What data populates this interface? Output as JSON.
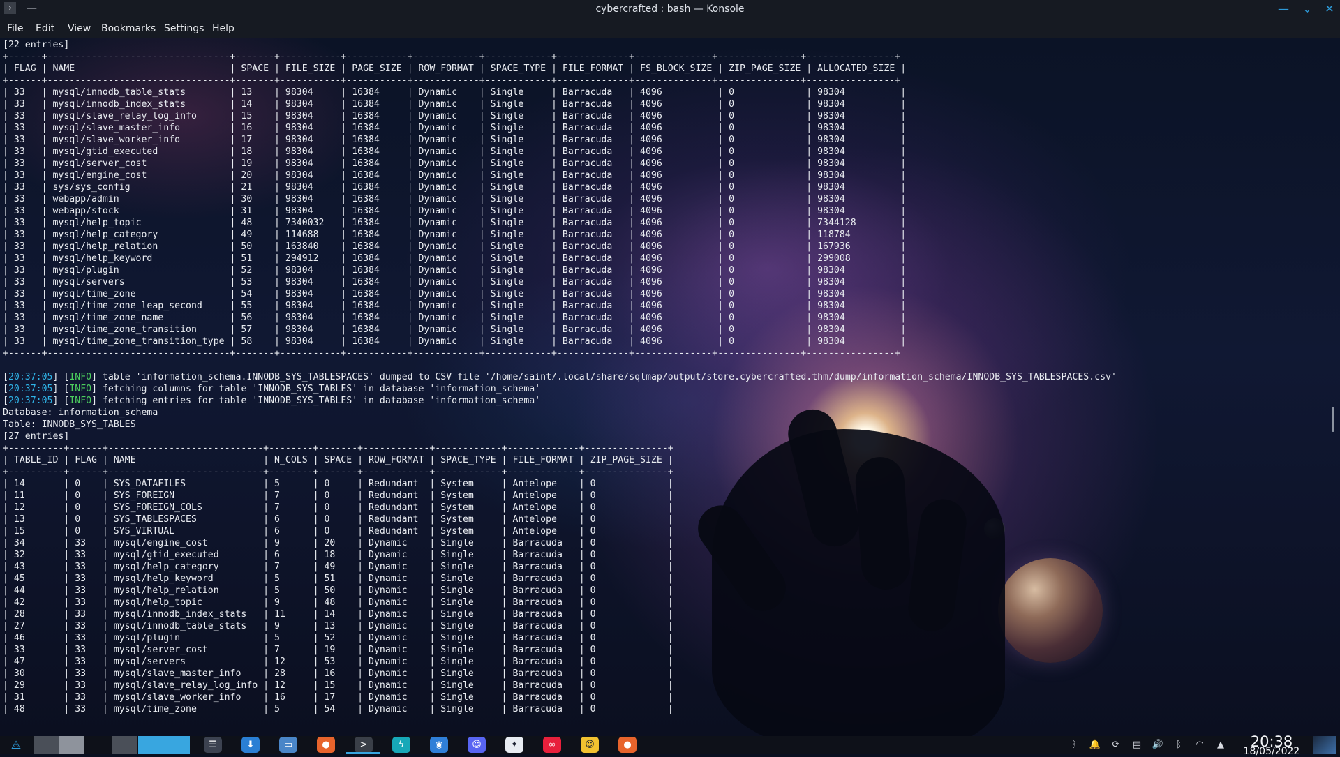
{
  "window": {
    "title": "cybercrafted : bash — Konsole",
    "app_icon": "terminal-icon"
  },
  "menu": [
    "File",
    "Edit",
    "View",
    "Bookmarks",
    "Settings",
    "Help"
  ],
  "terminal_lines": [
    "[22 entries]",
    "+------+---------------------------------+-------+-----------+-----------+------------+------------+-------------+--------------+---------------+----------------+",
    "| FLAG | NAME                            | SPACE | FILE_SIZE | PAGE_SIZE | ROW_FORMAT | SPACE_TYPE | FILE_FORMAT | FS_BLOCK_SIZE | ZIP_PAGE_SIZE | ALLOCATED_SIZE |",
    "+------+---------------------------------+-------+-----------+-----------+------------+------------+-------------+--------------+---------------+----------------+",
    "| 33   | mysql/innodb_table_stats        | 13    | 98304     | 16384     | Dynamic    | Single     | Barracuda   | 4096          | 0             | 98304          |",
    "| 33   | mysql/innodb_index_stats        | 14    | 98304     | 16384     | Dynamic    | Single     | Barracuda   | 4096          | 0             | 98304          |",
    "| 33   | mysql/slave_relay_log_info      | 15    | 98304     | 16384     | Dynamic    | Single     | Barracuda   | 4096          | 0             | 98304          |",
    "| 33   | mysql/slave_master_info         | 16    | 98304     | 16384     | Dynamic    | Single     | Barracuda   | 4096          | 0             | 98304          |",
    "| 33   | mysql/slave_worker_info         | 17    | 98304     | 16384     | Dynamic    | Single     | Barracuda   | 4096          | 0             | 98304          |",
    "| 33   | mysql/gtid_executed             | 18    | 98304     | 16384     | Dynamic    | Single     | Barracuda   | 4096          | 0             | 98304          |",
    "| 33   | mysql/server_cost               | 19    | 98304     | 16384     | Dynamic    | Single     | Barracuda   | 4096          | 0             | 98304          |",
    "| 33   | mysql/engine_cost               | 20    | 98304     | 16384     | Dynamic    | Single     | Barracuda   | 4096          | 0             | 98304          |",
    "| 33   | sys/sys_config                  | 21    | 98304     | 16384     | Dynamic    | Single     | Barracuda   | 4096          | 0             | 98304          |",
    "| 33   | webapp/admin                    | 30    | 98304     | 16384     | Dynamic    | Single     | Barracuda   | 4096          | 0             | 98304          |",
    "| 33   | webapp/stock                    | 31    | 98304     | 16384     | Dynamic    | Single     | Barracuda   | 4096          | 0             | 98304          |",
    "| 33   | mysql/help_topic                | 48    | 7340032   | 16384     | Dynamic    | Single     | Barracuda   | 4096          | 0             | 7344128        |",
    "| 33   | mysql/help_category             | 49    | 114688    | 16384     | Dynamic    | Single     | Barracuda   | 4096          | 0             | 118784         |",
    "| 33   | mysql/help_relation             | 50    | 163840    | 16384     | Dynamic    | Single     | Barracuda   | 4096          | 0             | 167936         |",
    "| 33   | mysql/help_keyword              | 51    | 294912    | 16384     | Dynamic    | Single     | Barracuda   | 4096          | 0             | 299008         |",
    "| 33   | mysql/plugin                    | 52    | 98304     | 16384     | Dynamic    | Single     | Barracuda   | 4096          | 0             | 98304          |",
    "| 33   | mysql/servers                   | 53    | 98304     | 16384     | Dynamic    | Single     | Barracuda   | 4096          | 0             | 98304          |",
    "| 33   | mysql/time_zone                 | 54    | 98304     | 16384     | Dynamic    | Single     | Barracuda   | 4096          | 0             | 98304          |",
    "| 33   | mysql/time_zone_leap_second     | 55    | 98304     | 16384     | Dynamic    | Single     | Barracuda   | 4096          | 0             | 98304          |",
    "| 33   | mysql/time_zone_name            | 56    | 98304     | 16384     | Dynamic    | Single     | Barracuda   | 4096          | 0             | 98304          |",
    "| 33   | mysql/time_zone_transition      | 57    | 98304     | 16384     | Dynamic    | Single     | Barracuda   | 4096          | 0             | 98304          |",
    "| 33   | mysql/time_zone_transition_type | 58    | 98304     | 16384     | Dynamic    | Single     | Barracuda   | 4096          | 0             | 98304          |",
    "+------+---------------------------------+-------+-----------+-----------+------------+------------+-------------+--------------+---------------+----------------+",
    "",
    "[20:37:05] [INFO] table 'information_schema.INNODB_SYS_TABLESPACES' dumped to CSV file '/home/saint/.local/share/sqlmap/output/store.cybercrafted.thm/dump/information_schema/INNODB_SYS_TABLESPACES.csv'",
    "[20:37:05] [INFO] fetching columns for table 'INNODB_SYS_TABLES' in database 'information_schema'",
    "[20:37:05] [INFO] fetching entries for table 'INNODB_SYS_TABLES' in database 'information_schema'",
    "Database: information_schema",
    "Table: INNODB_SYS_TABLES",
    "[27 entries]",
    "+----------+------+----------------------------+--------+-------+------------+------------+-------------+---------------+",
    "| TABLE_ID | FLAG | NAME                       | N_COLS | SPACE | ROW_FORMAT | SPACE_TYPE | FILE_FORMAT | ZIP_PAGE_SIZE |",
    "+----------+------+----------------------------+--------+-------+------------+------------+-------------+---------------+",
    "| 14       | 0    | SYS_DATAFILES              | 5      | 0     | Redundant  | System     | Antelope    | 0             |",
    "| 11       | 0    | SYS_FOREIGN                | 7      | 0     | Redundant  | System     | Antelope    | 0             |",
    "| 12       | 0    | SYS_FOREIGN_COLS           | 7      | 0     | Redundant  | System     | Antelope    | 0             |",
    "| 13       | 0    | SYS_TABLESPACES            | 6      | 0     | Redundant  | System     | Antelope    | 0             |",
    "| 15       | 0    | SYS_VIRTUAL                | 6      | 0     | Redundant  | System     | Antelope    | 0             |",
    "| 34       | 33   | mysql/engine_cost          | 9      | 20    | Dynamic    | Single     | Barracuda   | 0             |",
    "| 32       | 33   | mysql/gtid_executed        | 6      | 18    | Dynamic    | Single     | Barracuda   | 0             |",
    "| 43       | 33   | mysql/help_category        | 7      | 49    | Dynamic    | Single     | Barracuda   | 0             |",
    "| 45       | 33   | mysql/help_keyword         | 5      | 51    | Dynamic    | Single     | Barracuda   | 0             |",
    "| 44       | 33   | mysql/help_relation        | 5      | 50    | Dynamic    | Single     | Barracuda   | 0             |",
    "| 42       | 33   | mysql/help_topic           | 9      | 48    | Dynamic    | Single     | Barracuda   | 0             |",
    "| 28       | 33   | mysql/innodb_index_stats   | 11     | 14    | Dynamic    | Single     | Barracuda   | 0             |",
    "| 27       | 33   | mysql/innodb_table_stats   | 9      | 13    | Dynamic    | Single     | Barracuda   | 0             |",
    "| 46       | 33   | mysql/plugin               | 5      | 52    | Dynamic    | Single     | Barracuda   | 0             |",
    "| 33       | 33   | mysql/server_cost          | 7      | 19    | Dynamic    | Single     | Barracuda   | 0             |",
    "| 47       | 33   | mysql/servers              | 12     | 53    | Dynamic    | Single     | Barracuda   | 0             |",
    "| 30       | 33   | mysql/slave_master_info    | 28     | 16    | Dynamic    | Single     | Barracuda   | 0             |",
    "| 29       | 33   | mysql/slave_relay_log_info | 12     | 15    | Dynamic    | Single     | Barracuda   | 0             |",
    "| 31       | 33   | mysql/slave_worker_info    | 16     | 17    | Dynamic    | Single     | Barracuda   | 0             |",
    "| 48       | 33   | mysql/time_zone            | 5      | 54    | Dynamic    | Single     | Barracuda   | 0             |"
  ],
  "taskbar": {
    "launcher_icon": "plasma-launcher-icon",
    "apps": [
      {
        "name": "system-settings-icon",
        "color": "#3c4250",
        "glyph": "☰"
      },
      {
        "name": "discover-store-icon",
        "color": "#2a7fd4",
        "glyph": "⬇"
      },
      {
        "name": "file-manager-icon",
        "color": "#4a86c8",
        "glyph": "▭"
      },
      {
        "name": "firefox-icon",
        "color": "#e8642c",
        "glyph": "●"
      },
      {
        "name": "konsole-icon",
        "color": "#3a3f48",
        "glyph": ">"
      },
      {
        "name": "bolt-app-icon",
        "color": "#17a8b8",
        "glyph": "ϟ"
      },
      {
        "name": "browser-icon",
        "color": "#2f7fd8",
        "glyph": "◉"
      },
      {
        "name": "discord-icon",
        "color": "#5865f2",
        "glyph": "☺"
      },
      {
        "name": "vpn-icon",
        "color": "#e8ecf2",
        "glyph": "✦"
      },
      {
        "name": "media-player-icon",
        "color": "#e8203c",
        "glyph": "∞"
      },
      {
        "name": "emoji-icon",
        "color": "#f2c230",
        "glyph": "☺"
      },
      {
        "name": "firefox-dev-icon",
        "color": "#e8642c",
        "glyph": "●"
      }
    ],
    "tray": [
      {
        "name": "bluetooth-manager-icon",
        "glyph": "ᛒ"
      },
      {
        "name": "notifications-icon",
        "glyph": "🔔"
      },
      {
        "name": "sync-icon",
        "glyph": "⟳"
      },
      {
        "name": "clipboard-icon",
        "glyph": "▤"
      },
      {
        "name": "volume-icon",
        "glyph": "🔊"
      },
      {
        "name": "bluetooth-icon",
        "glyph": "ᛒ"
      },
      {
        "name": "wifi-icon",
        "glyph": "◠"
      },
      {
        "name": "tray-expand-icon",
        "glyph": "▲"
      }
    ],
    "clock": {
      "time": "20:38",
      "date": "18/05/2022"
    }
  },
  "colors": {
    "timestamp": "#2fb3e6",
    "info_tag": "#4ccf5e",
    "window_button": "#2e9ad8"
  }
}
